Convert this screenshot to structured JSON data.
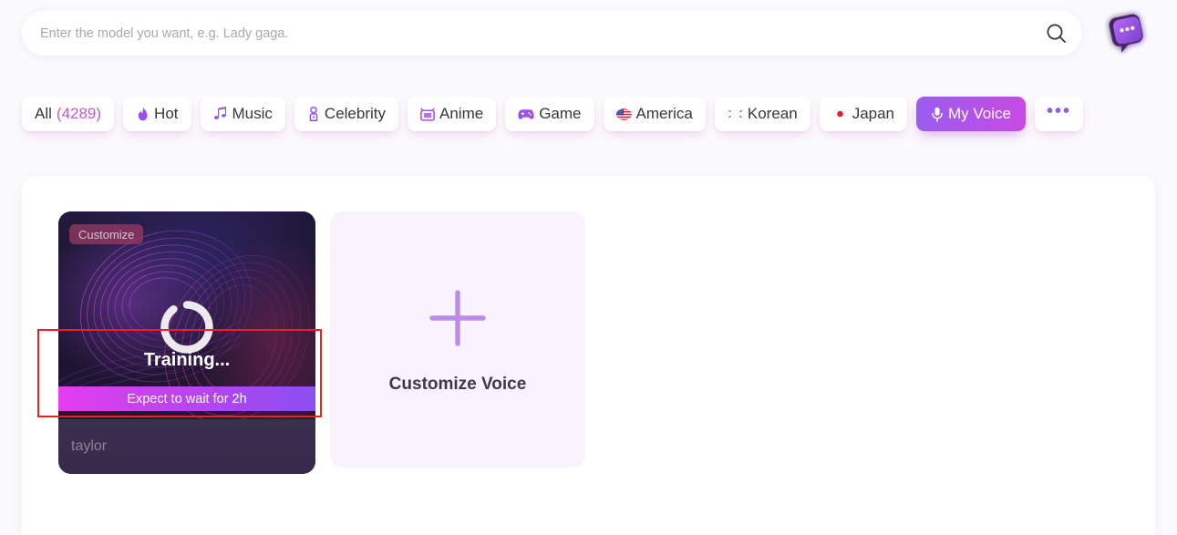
{
  "search": {
    "placeholder": "Enter the model you want, e.g. Lady gaga.",
    "value": "",
    "icon": "search-icon"
  },
  "logo": {
    "icon": "chat-bubble-app-logo"
  },
  "filters": [
    {
      "label": "All",
      "count": "(4289)",
      "icon": "",
      "active": false
    },
    {
      "label": "Hot",
      "icon": "fire-icon",
      "glyph": "🔥",
      "active": false
    },
    {
      "label": "Music",
      "icon": "music-note-icon",
      "glyph": "🎵",
      "active": false
    },
    {
      "label": "Celebrity",
      "icon": "celebrity-icon",
      "glyph": "🎖",
      "active": false
    },
    {
      "label": "Anime",
      "icon": "tv-icon",
      "glyph": "📺",
      "active": false
    },
    {
      "label": "Game",
      "icon": "gamepad-icon",
      "glyph": "🎮",
      "active": false
    },
    {
      "label": "America",
      "icon": "flag-us-icon",
      "glyph": "🇺🇸",
      "active": false
    },
    {
      "label": "Korean",
      "icon": "flag-kr-icon",
      "glyph": "🇰🇷",
      "active": false
    },
    {
      "label": "Japan",
      "icon": "flag-jp-icon",
      "glyph": "🇯🇵",
      "active": false
    },
    {
      "label": "My Voice",
      "icon": "microphone-icon",
      "active": true
    }
  ],
  "more_button": {
    "label": "•••",
    "icon": "more-horizontal-icon"
  },
  "voice_card": {
    "badge": "Customize",
    "status": "Training...",
    "progress_text": "Expect to wait for 2h",
    "name": "taylor",
    "spinner": "loading-spinner-icon"
  },
  "add_tile": {
    "label": "Customize Voice",
    "icon": "plus-icon"
  },
  "colors": {
    "accent_purple": "#9b5cf0",
    "accent_magenta": "#c84ae4",
    "count_text": "#c45ad0",
    "annotation_red": "#ef2020",
    "card_dark": "#2a1633",
    "tile_bg": "#faf2fd"
  }
}
